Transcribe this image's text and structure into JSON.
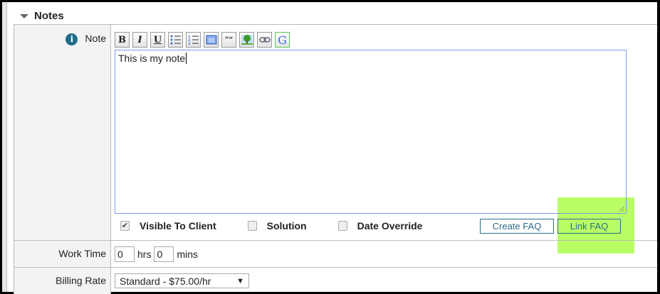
{
  "section": {
    "title": "Notes"
  },
  "note": {
    "label": "Note",
    "value": "This is my note",
    "toolbar": [
      "Bold",
      "Italic",
      "Underline",
      "Bulleted List",
      "Numbered List",
      "Insert Box",
      "Quote",
      "Insert Image",
      "Insert Link",
      "Google"
    ],
    "toolbar_glyphs": {
      "bold": "B",
      "italic": "I",
      "underline": "U",
      "quote": "”“",
      "google": "G"
    },
    "visible_to_client": {
      "label": "Visible To Client",
      "checked": true
    },
    "solution": {
      "label": "Solution",
      "checked": false
    },
    "date_override": {
      "label": "Date Override",
      "checked": false
    },
    "create_faq": "Create FAQ",
    "link_faq": "Link FAQ"
  },
  "work_time": {
    "label": "Work Time",
    "hrs": "0",
    "hrs_label": "hrs",
    "mins": "0",
    "mins_label": "mins"
  },
  "billing_rate": {
    "label": "Billing Rate",
    "value": "Standard - $75.00/hr",
    "arrow": "▼"
  },
  "colors": {
    "highlight": "#a8ff4a",
    "accent": "#2b6c8a"
  }
}
